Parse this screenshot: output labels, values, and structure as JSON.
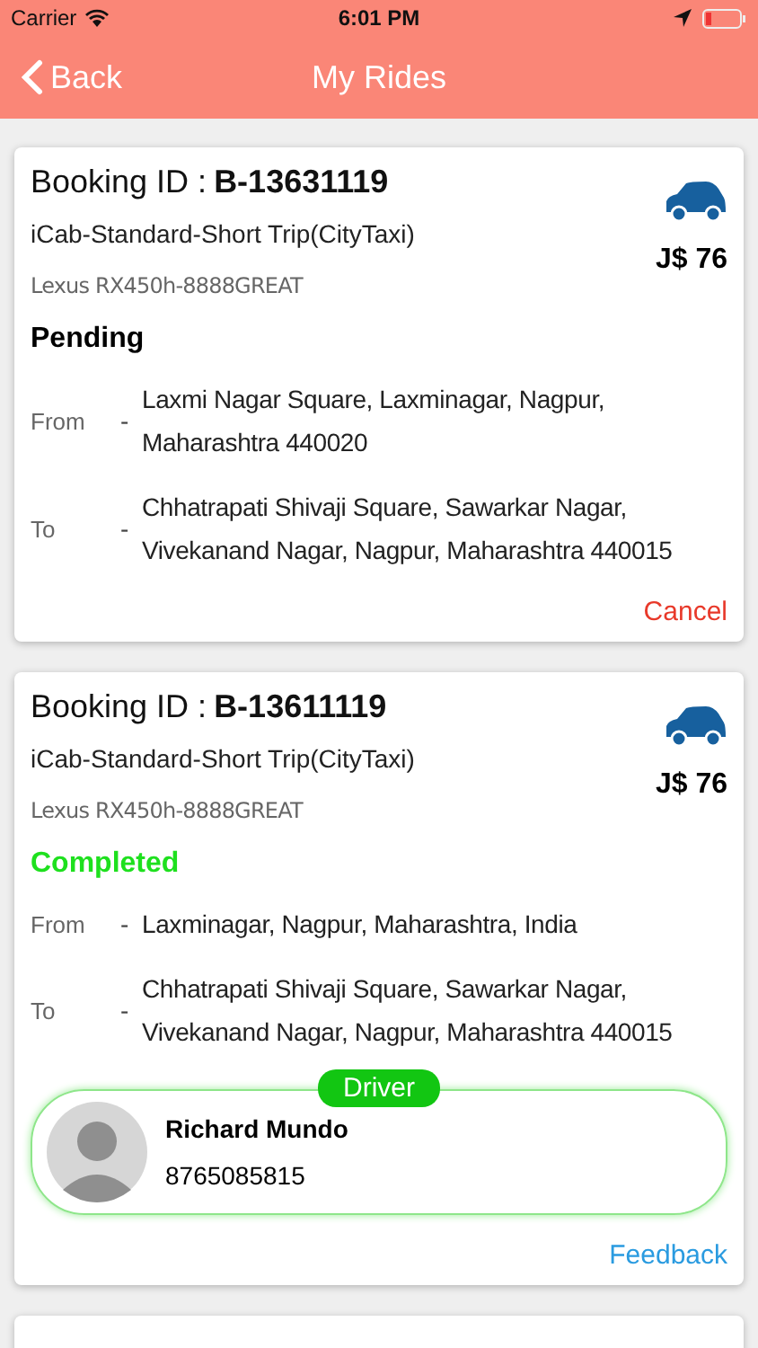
{
  "status_bar": {
    "carrier": "Carrier",
    "time": "6:01 PM"
  },
  "nav": {
    "back": "Back",
    "title": "My Rides"
  },
  "rides": [
    {
      "booking_label": "Booking ID :",
      "booking_id": "B-13631119",
      "service": "iCab-Standard-Short Trip(CityTaxi)",
      "vehicle": "Lexus RX450h-8888GREAT",
      "fare": "J$ 76",
      "status": "Pending",
      "completed": false,
      "from_label": "From",
      "from_separator": "-",
      "from": "Laxmi Nagar Square, Laxminagar, Nagpur, Maharashtra 440020",
      "to_label": "To",
      "to_separator": "-",
      "to": "Chhatrapati Shivaji Square, Sawarkar Nagar, Vivekanand Nagar, Nagpur, Maharashtra 440015",
      "action": {
        "label": "Cancel",
        "kind": "cancel"
      }
    },
    {
      "booking_label": "Booking ID :",
      "booking_id": "B-13611119",
      "service": "iCab-Standard-Short Trip(CityTaxi)",
      "vehicle": "Lexus RX450h-8888GREAT",
      "fare": "J$ 76",
      "status": "Completed",
      "completed": true,
      "from_label": "From",
      "from_separator": "-",
      "from": "Laxminagar, Nagpur, Maharashtra, India",
      "to_label": "To",
      "to_separator": "-",
      "to": "Chhatrapati Shivaji Square, Sawarkar Nagar, Vivekanand Nagar, Nagpur, Maharashtra 440015",
      "driver": {
        "badge": "Driver",
        "name": "Richard Mundo",
        "phone": "8765085815"
      },
      "action": {
        "label": "Feedback",
        "kind": "feedback"
      }
    }
  ]
}
